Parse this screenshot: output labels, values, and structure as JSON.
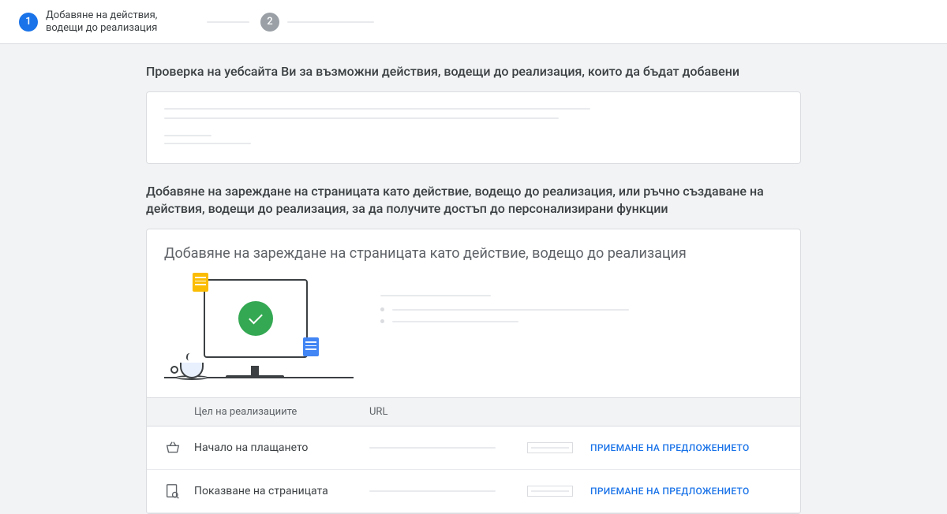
{
  "stepper": {
    "step1_number": "1",
    "step1_label": "Добавяне на действия, водещи до реализация",
    "step2_number": "2"
  },
  "section1": {
    "title": "Проверка на уебсайта Ви за възможни действия, водещи до реализация, които да бъдат добавени"
  },
  "section2": {
    "title": "Добавяне на зареждане на страницата като действие, водещо до реализация, или ръчно създаване на действия, водещи до реализация, за да получите достъп до персонализирани функции",
    "card_heading": "Добавяне на зареждане на страницата като действие, водещо до реализация",
    "table": {
      "col_goal": "Цел на реализациите",
      "col_url": "URL",
      "rows": [
        {
          "icon": "basket",
          "goal": "Начало на плащането",
          "action": "ПРИЕМАНЕ НА ПРЕДЛОЖЕНИЕТО"
        },
        {
          "icon": "page-search",
          "goal": "Показване на страницата",
          "action": "ПРИЕМАНЕ НА ПРЕДЛОЖЕНИЕТО"
        }
      ]
    }
  }
}
